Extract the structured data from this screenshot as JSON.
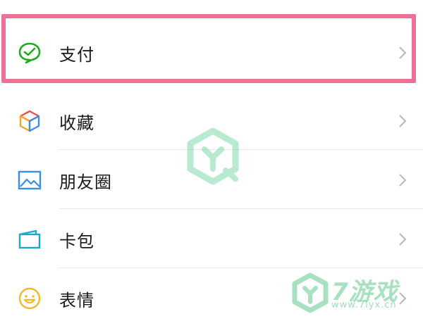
{
  "menu": {
    "items": [
      {
        "label": "支付",
        "icon": "wechat-pay-icon"
      },
      {
        "label": "收藏",
        "icon": "favorites-cube-icon"
      },
      {
        "label": "朋友圈",
        "icon": "moments-picture-icon"
      },
      {
        "label": "卡包",
        "icon": "card-wallet-icon"
      },
      {
        "label": "表情",
        "icon": "sticker-smile-icon"
      }
    ]
  },
  "watermark": {
    "brand": "7游戏",
    "url": "www.7lyx.cn"
  },
  "colors": {
    "highlight": "#ee7195",
    "pay_green": "#1aad19",
    "watermark_green": "#60c88c"
  }
}
